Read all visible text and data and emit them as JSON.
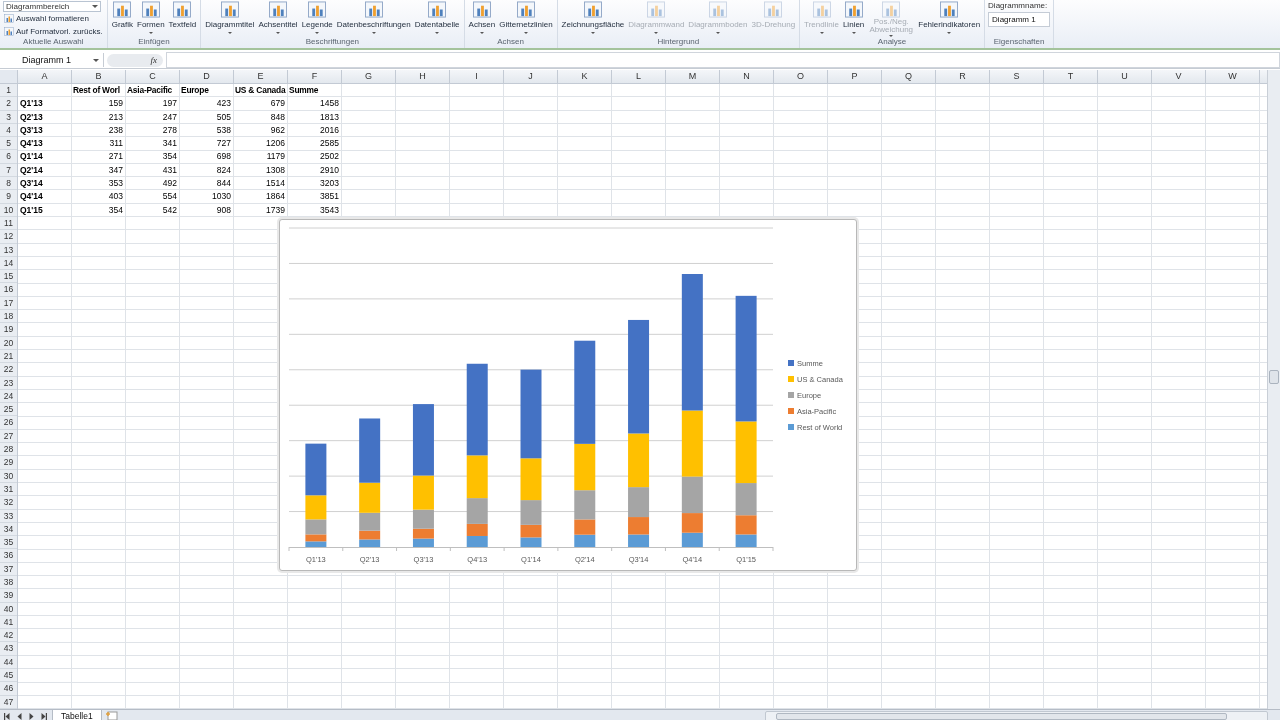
{
  "ribbon": {
    "groups": [
      {
        "label": "Aktuelle Auswahl",
        "items": [
          {
            "kind": "dropdown",
            "label": "Diagrammbereich"
          },
          {
            "kind": "small",
            "label": "Auswahl formatieren"
          },
          {
            "kind": "small",
            "label": "Auf Formatvorl. zurücks."
          }
        ]
      },
      {
        "label": "Einfügen",
        "items": [
          {
            "kind": "large",
            "label": "Grafik",
            "dropdown": false,
            "disabled": false
          },
          {
            "kind": "large",
            "label": "Formen",
            "dropdown": true,
            "disabled": false
          },
          {
            "kind": "large",
            "label": "Textfeld",
            "dropdown": false,
            "disabled": false
          }
        ]
      },
      {
        "label": "Beschriftungen",
        "items": [
          {
            "kind": "large",
            "label": "Diagrammtitel",
            "dropdown": true,
            "disabled": false
          },
          {
            "kind": "large",
            "label": "Achsentitel",
            "dropdown": true,
            "disabled": false
          },
          {
            "kind": "large",
            "label": "Legende",
            "dropdown": true,
            "disabled": false
          },
          {
            "kind": "large",
            "label": "Datenbeschriftungen",
            "dropdown": true,
            "disabled": false
          },
          {
            "kind": "large",
            "label": "Datentabelle",
            "dropdown": true,
            "disabled": false
          }
        ]
      },
      {
        "label": "Achsen",
        "items": [
          {
            "kind": "large",
            "label": "Achsen",
            "dropdown": true,
            "disabled": false
          },
          {
            "kind": "large",
            "label": "Gitternetzlinien",
            "dropdown": true,
            "disabled": false
          }
        ]
      },
      {
        "label": "Hintergrund",
        "items": [
          {
            "kind": "large",
            "label": "Zeichnungsfläche",
            "dropdown": true,
            "disabled": false
          },
          {
            "kind": "large",
            "label": "Diagrammwand",
            "dropdown": true,
            "disabled": true
          },
          {
            "kind": "large",
            "label": "Diagrammboden",
            "dropdown": true,
            "disabled": true
          },
          {
            "kind": "large",
            "label": "3D-Drehung",
            "dropdown": false,
            "disabled": true
          }
        ]
      },
      {
        "label": "Analyse",
        "items": [
          {
            "kind": "large",
            "label": "Trendlinie",
            "dropdown": true,
            "disabled": true
          },
          {
            "kind": "large",
            "label": "Linien",
            "dropdown": true,
            "disabled": false
          },
          {
            "kind": "large_two_line",
            "label": "Pos./Neg. Abweichung",
            "dropdown": true,
            "disabled": true
          },
          {
            "kind": "large",
            "label": "Fehlerindikatoren",
            "dropdown": true,
            "disabled": false
          }
        ]
      },
      {
        "label": "Eigenschaften",
        "items": [
          {
            "kind": "namefield",
            "label": "Diagrammname:",
            "value": "Diagramm 1"
          }
        ]
      }
    ]
  },
  "formula_bar": {
    "name_box": "Diagramm 1",
    "function_label": "fx"
  },
  "sheet": {
    "columns": [
      "A",
      "B",
      "C",
      "D",
      "E",
      "F",
      "G",
      "H",
      "I",
      "J",
      "K",
      "L",
      "M",
      "N",
      "O",
      "P",
      "Q",
      "R",
      "S",
      "T",
      "U",
      "V",
      "W"
    ],
    "row_numbers": [
      "1",
      "2",
      "3",
      "4",
      "5",
      "6",
      "7",
      "8",
      "9",
      "10",
      "11",
      "12",
      "13",
      "14",
      "15",
      "16",
      "17",
      "18",
      "19",
      "20",
      "21",
      "22",
      "23",
      "24",
      "25",
      "26",
      "27",
      "28",
      "29",
      "30",
      "31",
      "32",
      "33",
      "34",
      "35",
      "36",
      "37",
      "38",
      "39",
      "40",
      "41",
      "42",
      "43",
      "44",
      "45",
      "46",
      "47"
    ]
  },
  "table": {
    "columns": [
      "Rest of Worl",
      "Asia-Pacific",
      "Europe",
      "US & Canada",
      "Summe"
    ],
    "rows": [
      {
        "label": "Q1'13",
        "values": [
          "159",
          "197",
          "423",
          "679",
          "1458"
        ]
      },
      {
        "label": "Q2'13",
        "values": [
          "213",
          "247",
          "505",
          "848",
          "1813"
        ]
      },
      {
        "label": "Q3'13",
        "values": [
          "238",
          "278",
          "538",
          "962",
          "2016"
        ]
      },
      {
        "label": "Q4'13",
        "values": [
          "311",
          "341",
          "727",
          "1206",
          "2585"
        ]
      },
      {
        "label": "Q1'14",
        "values": [
          "271",
          "354",
          "698",
          "1179",
          "2502"
        ]
      },
      {
        "label": "Q2'14",
        "values": [
          "347",
          "431",
          "824",
          "1308",
          "2910"
        ]
      },
      {
        "label": "Q3'14",
        "values": [
          "353",
          "492",
          "844",
          "1514",
          "3203"
        ]
      },
      {
        "label": "Q4'14",
        "values": [
          "403",
          "554",
          "1030",
          "1864",
          "3851"
        ]
      },
      {
        "label": "Q1'15",
        "values": [
          "354",
          "542",
          "908",
          "1739",
          "3543"
        ]
      }
    ]
  },
  "chart": {
    "categories": [
      "Q1'13",
      "Q2'13",
      "Q3'13",
      "Q4'13",
      "Q1'14",
      "Q2'14",
      "Q3'14",
      "Q4'14",
      "Q1'15"
    ],
    "series": [
      {
        "name": "Summe",
        "color": "#4472c4"
      },
      {
        "name": "US & Canada",
        "color": "#ffc000"
      },
      {
        "name": "Europe",
        "color": "#a5a5a5"
      },
      {
        "name": "Asia-Pacific",
        "color": "#ed7d31"
      },
      {
        "name": "Rest of World",
        "color": "#5b9bd5"
      }
    ]
  },
  "sheet_tabs": [
    {
      "label": "Tabelle1",
      "selected": true
    }
  ]
}
